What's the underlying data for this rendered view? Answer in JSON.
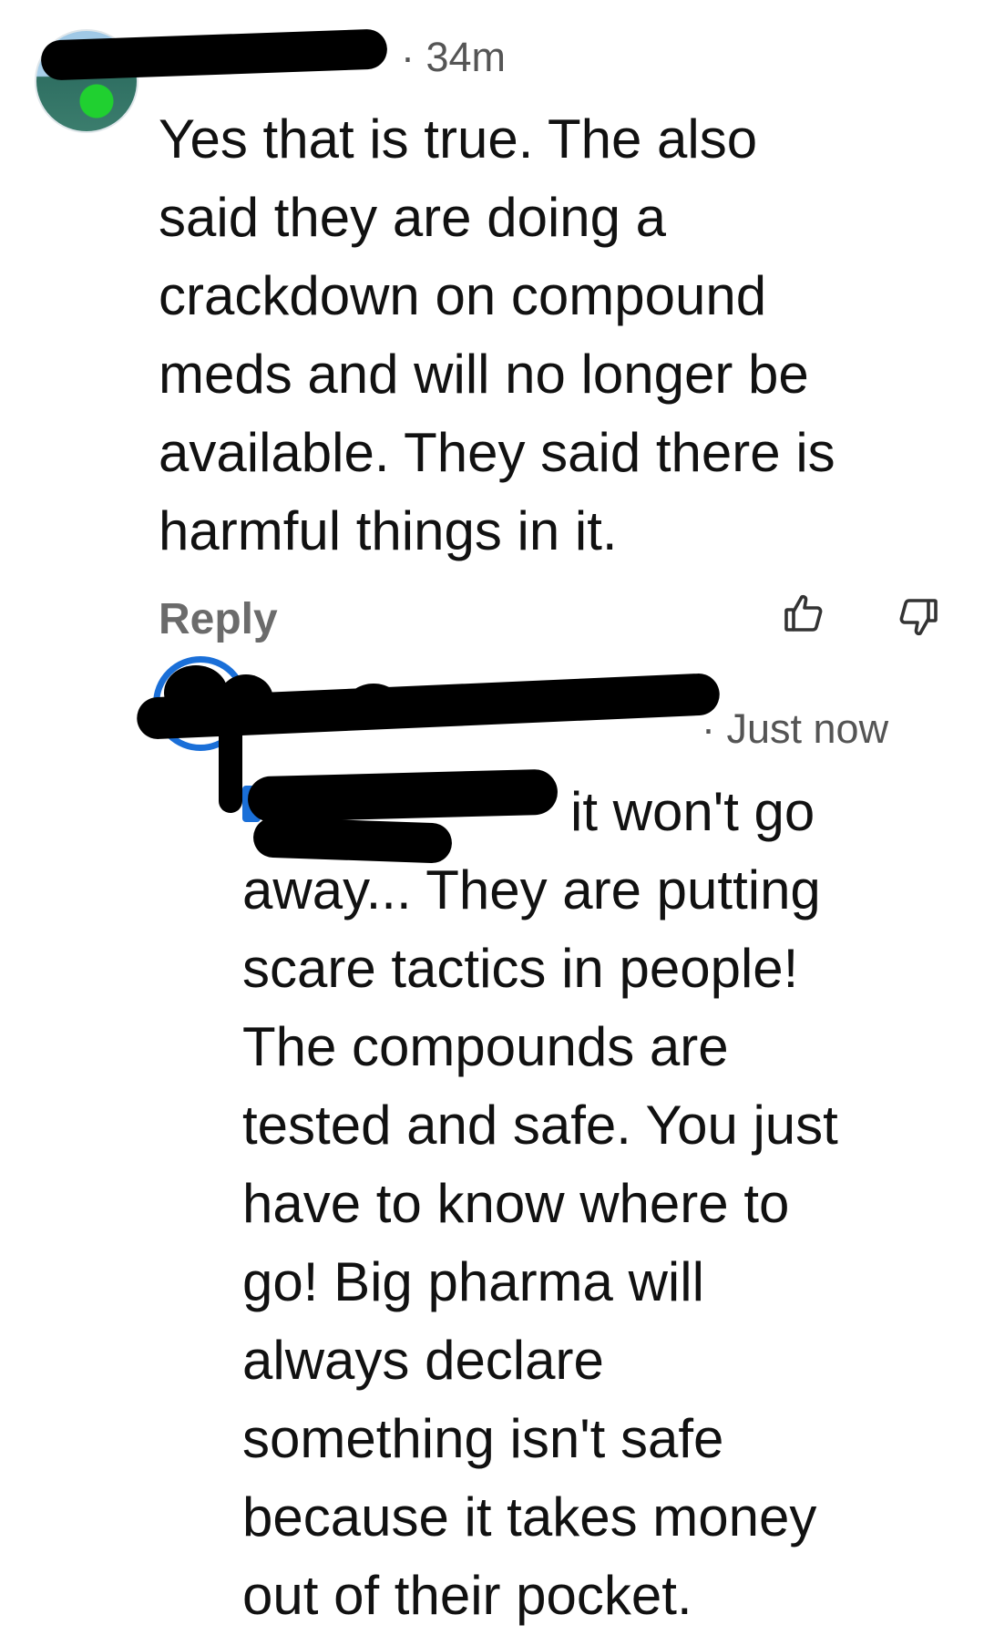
{
  "comments": [
    {
      "time": "34m",
      "text": "Yes that is true. The also said they are doing a crackdown on compound meds and will no longer be available. They said there is harmful things in it.",
      "lines": [
        "Yes that is true. The also",
        "said they are doing a",
        "crackdown on compound",
        "meds and will no longer be",
        "available. They said there is",
        "harmful things in it."
      ],
      "reply_label": "Reply",
      "actions": {
        "like_icon": "thumbs-up-icon",
        "dislike_icon": "thumbs-down-icon"
      }
    },
    {
      "time": "Just now",
      "lines": [
        "it won't go",
        "away... They are putting",
        "scare tactics in people!",
        "The compounds are",
        "tested and safe. You just",
        "have to know where to",
        "go! Big pharma will",
        "always declare",
        "something isn't safe",
        "because it takes money",
        "out of their pocket."
      ]
    }
  ],
  "colors": {
    "meta_gray": "#555555",
    "reply_gray": "#6b6b6b",
    "mention_blue": "#1a6fd8"
  }
}
